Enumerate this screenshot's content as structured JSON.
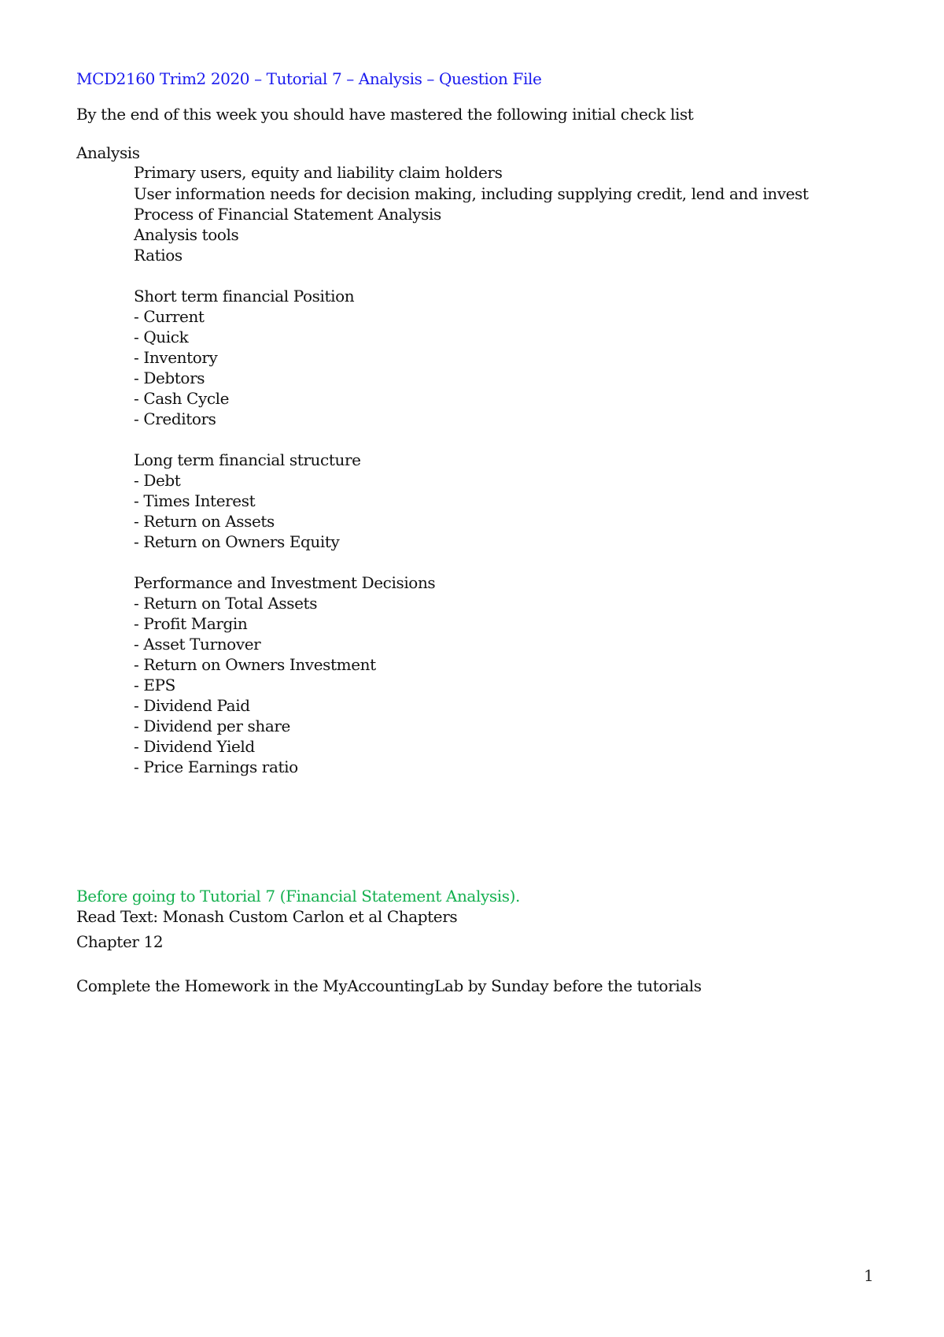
{
  "document": {
    "title": "MCD2160 Trim2 2020 – Tutorial 7 – Analysis – Question File",
    "intro": "By the end of this week you should have mastered the following initial check list",
    "analysis": {
      "heading": "Analysis",
      "items": [
        "Primary users, equity and liability claim holders",
        "User information needs for decision making, including supplying credit, lend and invest",
        "Process of Financial Statement Analysis",
        "Analysis tools",
        "Ratios"
      ]
    },
    "sections": [
      {
        "heading": "Short term financial Position",
        "items": [
          "- Current",
          "- Quick",
          "- Inventory",
          "- Debtors",
          "- Cash Cycle",
          "- Creditors"
        ]
      },
      {
        "heading": "Long term financial structure",
        "items": [
          "- Debt",
          "- Times Interest",
          "- Return on Assets",
          "- Return on Owners Equity"
        ]
      },
      {
        "heading": "Performance and Investment Decisions",
        "items": [
          "- Return on Total Assets",
          "- Profit Margin",
          "- Asset Turnover",
          "- Return on Owners Investment",
          "- EPS",
          "- Dividend Paid",
          "- Dividend per share",
          "- Dividend Yield",
          "- Price Earnings ratio"
        ]
      }
    ],
    "before_tutorial": {
      "heading": "Before going to Tutorial 7 (Financial Statement Analysis).",
      "read_text": "Read Text: Monash Custom Carlon et al Chapters",
      "chapter": "Chapter 12",
      "homework": "Complete the Homework in the MyAccountingLab by Sunday before the tutorials"
    },
    "page_number": "1"
  },
  "colors": {
    "title": "#1a1aee",
    "before_heading": "#14b04f",
    "body_text": "#111111"
  }
}
